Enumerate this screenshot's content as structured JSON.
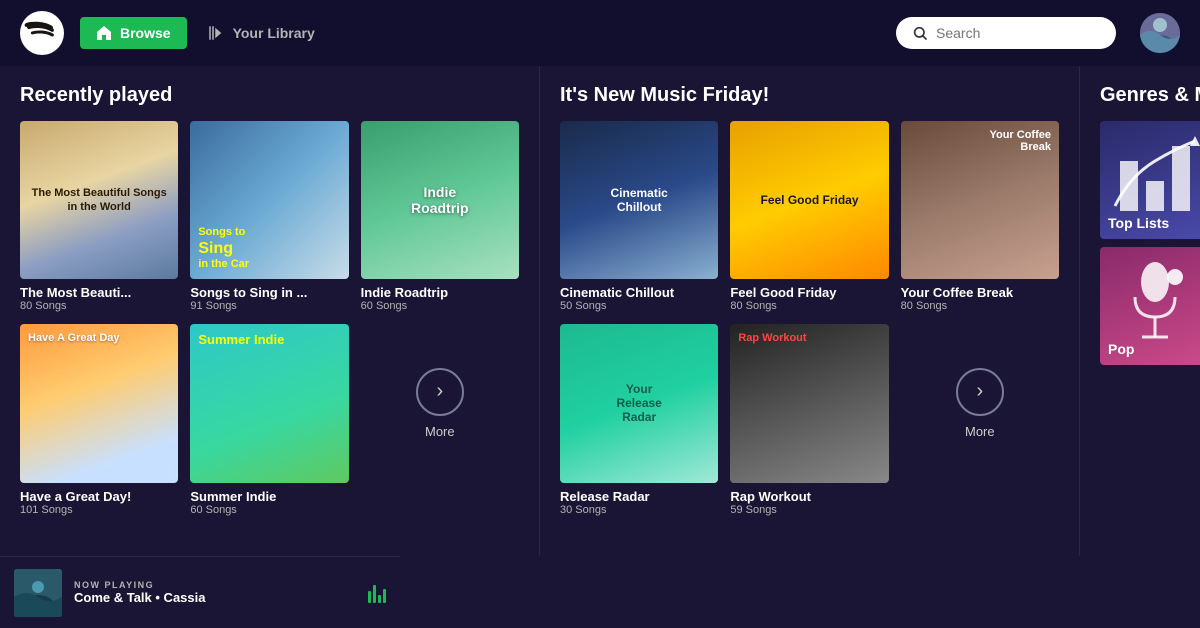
{
  "nav": {
    "browse_label": "Browse",
    "library_label": "Your Library",
    "search_placeholder": "Search"
  },
  "recently_played": {
    "section_title": "Recently played",
    "cards": [
      {
        "title": "The Most Beauti...",
        "subtitle": "80 Songs",
        "art": "most-beautiful"
      },
      {
        "title": "Songs to Sing in ...",
        "subtitle": "91 Songs",
        "art": "sing-car"
      },
      {
        "title": "Indie Roadtrip",
        "subtitle": "60 Songs",
        "art": "indie-road"
      },
      {
        "title": "Have a Great Day!",
        "subtitle": "101 Songs",
        "art": "great-day"
      },
      {
        "title": "Summer Indie",
        "subtitle": "60 Songs",
        "art": "summer-indie"
      },
      {
        "title": "More",
        "subtitle": "",
        "art": "more"
      }
    ]
  },
  "new_music": {
    "section_title": "It's New Music Friday!",
    "cards": [
      {
        "title": "Cinematic Chillout",
        "subtitle": "50 Songs",
        "art": "cinematic"
      },
      {
        "title": "Feel Good Friday",
        "subtitle": "80 Songs",
        "art": "feel-good"
      },
      {
        "title": "Your Coffee Break",
        "subtitle": "80 Songs",
        "art": "coffee"
      },
      {
        "title": "Release Radar",
        "subtitle": "30 Songs",
        "art": "release-radar"
      },
      {
        "title": "Rap Workout",
        "subtitle": "59 Songs",
        "art": "rap-workout"
      },
      {
        "title": "More",
        "subtitle": "",
        "art": "more"
      }
    ]
  },
  "genres": {
    "section_title": "Genres & M",
    "items": [
      {
        "label": "Top Lists",
        "art": "top-lists"
      },
      {
        "label": "Pop",
        "art": "pop"
      }
    ]
  },
  "now_playing": {
    "label": "NOW PLAYING",
    "song": "Come & Talk • Cassia"
  },
  "art_text": {
    "most_beautiful_line1": "The Most Beautiful Songs",
    "most_beautiful_line2": "in the World",
    "sing_car": "Songs to\nSing\nin the Car",
    "indie_roadtrip": "Indie\nRoadtrip",
    "have_great_day": "Have A Great Day",
    "summer_indie": "Summer Indie",
    "cinematic": "Cinematic\nChillout",
    "feel_good": "Feel Good Friday",
    "coffee": "Your Coffee\nBreak",
    "release_radar": "Your\nRelease\nRadar",
    "rap_workout": "Rap Workout"
  }
}
